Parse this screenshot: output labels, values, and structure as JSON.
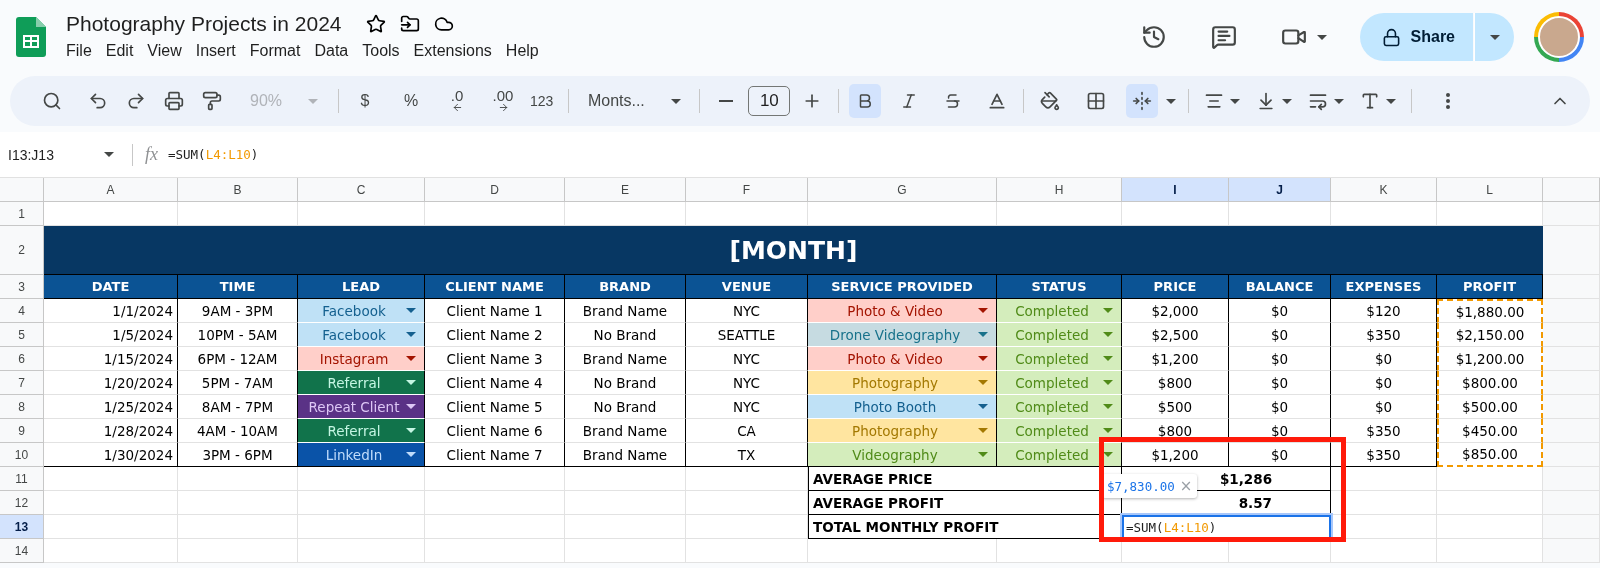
{
  "app": {
    "title": "Photography Projects in 2024",
    "menu": [
      "File",
      "Edit",
      "View",
      "Insert",
      "Format",
      "Data",
      "Tools",
      "Extensions",
      "Help"
    ],
    "share": "Share"
  },
  "toolbar": {
    "zoom": {
      "label": "90%",
      "disabled": true
    },
    "currency": "$",
    "percent": "%",
    "decrease_decimal": ".0",
    "increase_decimal": ".00",
    "number_format": "123",
    "font": "Monts...",
    "font_size": "10",
    "bold": {
      "on": true
    },
    "merge": {
      "on": true
    }
  },
  "formula_bar": {
    "name_box": "I13:J13",
    "fx": "fx",
    "formula": {
      "start": "=SUM(",
      "ref": "L4:L10",
      "end": ")"
    }
  },
  "sheet": {
    "column_letters": [
      {
        "label": "A",
        "selected": false
      },
      {
        "label": "B",
        "selected": false
      },
      {
        "label": "C",
        "selected": false
      },
      {
        "label": "D",
        "selected": false
      },
      {
        "label": "E",
        "selected": false
      },
      {
        "label": "F",
        "selected": false
      },
      {
        "label": "G",
        "selected": false
      },
      {
        "label": "H",
        "selected": false
      },
      {
        "label": "I",
        "selected": true
      },
      {
        "label": "J",
        "selected": true
      },
      {
        "label": "K",
        "selected": false
      },
      {
        "label": "L",
        "selected": false
      }
    ],
    "row_numbers": [
      {
        "label": "1",
        "selected": false
      },
      {
        "label": "2",
        "selected": false
      },
      {
        "label": "3",
        "selected": false
      },
      {
        "label": "4",
        "selected": false
      },
      {
        "label": "5",
        "selected": false
      },
      {
        "label": "6",
        "selected": false
      },
      {
        "label": "7",
        "selected": false
      },
      {
        "label": "8",
        "selected": false
      },
      {
        "label": "9",
        "selected": false
      },
      {
        "label": "10",
        "selected": false
      },
      {
        "label": "11",
        "selected": false
      },
      {
        "label": "12",
        "selected": false
      },
      {
        "label": "13",
        "selected": true
      },
      {
        "label": "14",
        "selected": false
      }
    ],
    "title": "[MONTH]",
    "columns": [
      {
        "header": "DATE",
        "referenced": false
      },
      {
        "header": "TIME",
        "referenced": false
      },
      {
        "header": "LEAD",
        "referenced": false
      },
      {
        "header": "CLIENT NAME",
        "referenced": false
      },
      {
        "header": "BRAND",
        "referenced": false
      },
      {
        "header": "VENUE",
        "referenced": false
      },
      {
        "header": "SERVICE PROVIDED",
        "referenced": false
      },
      {
        "header": "STATUS",
        "referenced": false
      },
      {
        "header": "PRICE",
        "referenced": false
      },
      {
        "header": "BALANCE",
        "referenced": false
      },
      {
        "header": "EXPENSES",
        "referenced": false
      },
      {
        "header": "PROFIT",
        "referenced": true
      }
    ],
    "rows": [
      {
        "date": "1/1/2024",
        "time": "9AM - 3PM",
        "lead": {
          "label": "Facebook",
          "color": "#bfe1f6"
        },
        "client": "Client Name 1",
        "brand": "Brand Name",
        "venue": "NYC",
        "service": {
          "label": "Photo & Video",
          "color": "#ffcfc9"
        },
        "status": {
          "label": "Completed",
          "color": "#d4edbc"
        },
        "price": "$2,000",
        "balance": "$0",
        "expenses": "$120",
        "profit": "$1,880.00"
      },
      {
        "date": "1/5/2024",
        "time": "10PM - 5AM",
        "lead": {
          "label": "Facebook",
          "color": "#bfe1f6"
        },
        "client": "Client Name 2",
        "brand": "No Brand",
        "venue": "SEATTLE",
        "service": {
          "label": "Drone Videography",
          "color": "#c6dbe1"
        },
        "status": {
          "label": "Completed",
          "color": "#d4edbc"
        },
        "price": "$2,500",
        "balance": "$0",
        "expenses": "$350",
        "profit": "$2,150.00"
      },
      {
        "date": "1/15/2024",
        "time": "6PM - 12AM",
        "lead": {
          "label": "Instagram",
          "color": "#ffcfc9"
        },
        "client": "Client Name 3",
        "brand": "Brand Name",
        "venue": "NYC",
        "service": {
          "label": "Photo & Video",
          "color": "#ffcfc9"
        },
        "status": {
          "label": "Completed",
          "color": "#d4edbc"
        },
        "price": "$1,200",
        "balance": "$0",
        "expenses": "$0",
        "profit": "$1,200.00"
      },
      {
        "date": "1/20/2024",
        "time": "5PM - 7AM",
        "lead": {
          "label": "Referral",
          "color": "#11734b"
        },
        "client": "Client Name 4",
        "brand": "No Brand",
        "venue": "NYC",
        "service": {
          "label": "Photography",
          "color": "#ffe5a0"
        },
        "status": {
          "label": "Completed",
          "color": "#d4edbc"
        },
        "price": "$800",
        "balance": "$0",
        "expenses": "$0",
        "profit": "$800.00"
      },
      {
        "date": "1/25/2024",
        "time": "8AM - 7PM",
        "lead": {
          "label": "Repeat Client",
          "color": "#5a3286"
        },
        "client": "Client Name 5",
        "brand": "No Brand",
        "venue": "NYC",
        "service": {
          "label": "Photo Booth",
          "color": "#bfe1f6"
        },
        "status": {
          "label": "Completed",
          "color": "#d4edbc"
        },
        "price": "$500",
        "balance": "$0",
        "expenses": "$0",
        "profit": "$500.00"
      },
      {
        "date": "1/28/2024",
        "time": "4AM - 10AM",
        "lead": {
          "label": "Referral",
          "color": "#11734b"
        },
        "client": "Client Name 6",
        "brand": "Brand Name",
        "venue": "CA",
        "service": {
          "label": "Photography",
          "color": "#ffe5a0"
        },
        "status": {
          "label": "Completed",
          "color": "#d4edbc"
        },
        "price": "$800",
        "balance": "$0",
        "expenses": "$350",
        "profit": "$450.00"
      },
      {
        "date": "1/30/2024",
        "time": "3PM - 6PM",
        "lead": {
          "label": "LinkedIn",
          "color": "#0a53a8"
        },
        "client": "Client Name 7",
        "brand": "Brand Name",
        "venue": "TX",
        "service": {
          "label": "Videography",
          "color": "#d4edbc"
        },
        "status": {
          "label": "Completed",
          "color": "#d4edbc"
        },
        "price": "$1,200",
        "balance": "$0",
        "expenses": "$350",
        "profit": "$850.00"
      }
    ],
    "summary": [
      {
        "label": "AVERAGE PRICE",
        "kind": "value",
        "value": "$1,286"
      },
      {
        "label": "AVERAGE PROFIT",
        "kind": "value",
        "value": "8.57"
      },
      {
        "label": "TOTAL MONTHLY PROFIT",
        "kind": "editor",
        "formula": {
          "start": "=SUM(",
          "ref": "L4:L10",
          "end": ")"
        }
      }
    ],
    "sum_preview": {
      "value": "$7,830.00",
      "close": "×"
    }
  }
}
